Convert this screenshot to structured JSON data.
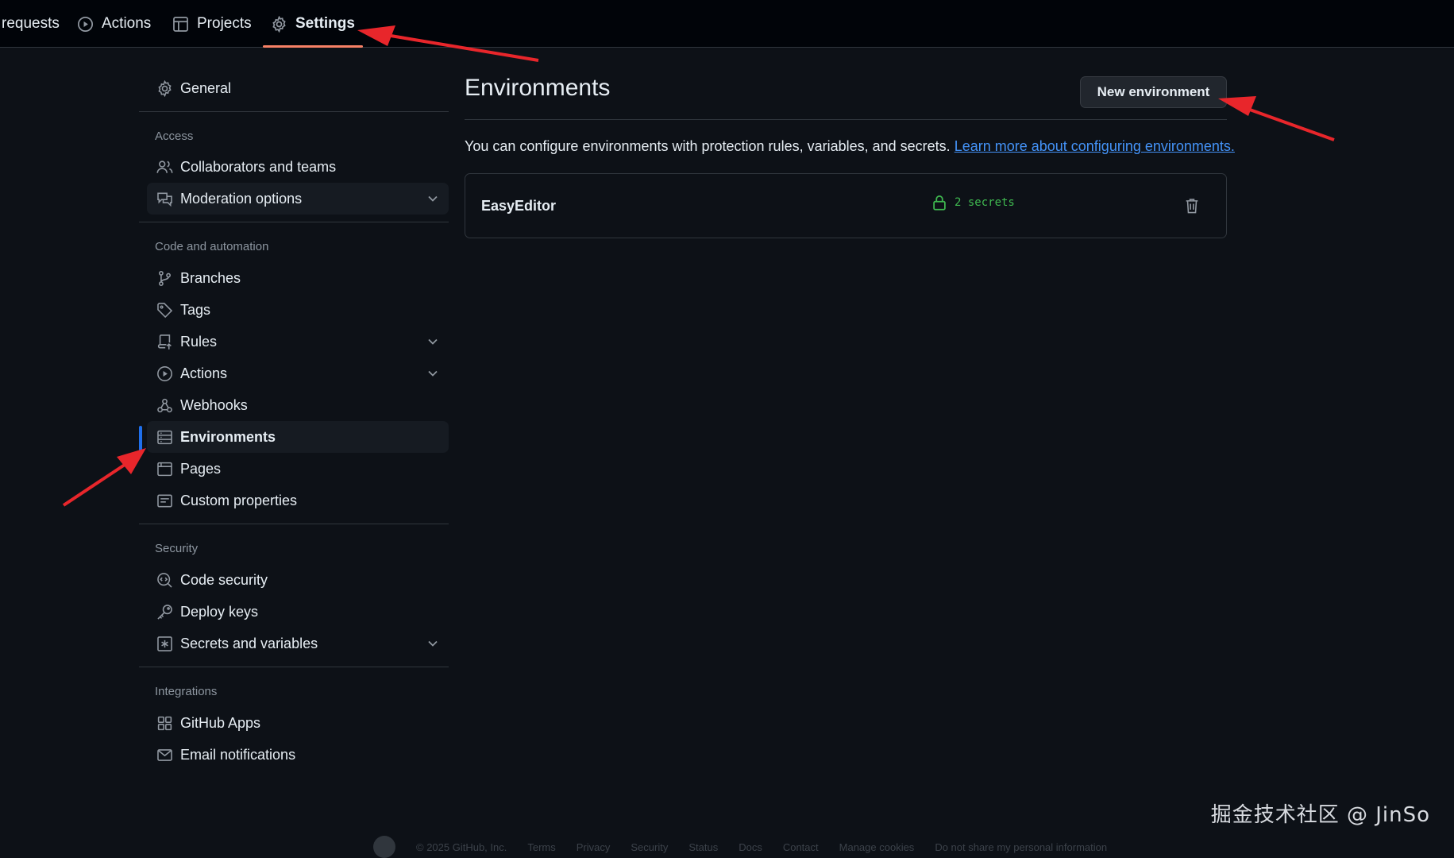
{
  "nav": {
    "tabs": [
      {
        "label": "requests",
        "icon": "pull-request-icon"
      },
      {
        "label": "Actions",
        "icon": "play-circle-icon"
      },
      {
        "label": "Projects",
        "icon": "table-icon"
      },
      {
        "label": "Settings",
        "icon": "gear-icon",
        "selected": true
      }
    ]
  },
  "sidebar": {
    "general": "General",
    "sections": {
      "access": "Access",
      "code_automation": "Code and automation",
      "security": "Security",
      "integrations": "Integrations"
    },
    "items": {
      "collaborators": "Collaborators and teams",
      "moderation": "Moderation options",
      "branches": "Branches",
      "tags": "Tags",
      "rules": "Rules",
      "actions": "Actions",
      "webhooks": "Webhooks",
      "environments": "Environments",
      "pages": "Pages",
      "custom_properties": "Custom properties",
      "code_security": "Code security",
      "deploy_keys": "Deploy keys",
      "secrets_variables": "Secrets and variables",
      "github_apps": "GitHub Apps",
      "email_notifications": "Email notifications"
    },
    "active_item": "Environments"
  },
  "main": {
    "title": "Environments",
    "new_button": "New environment",
    "description": "You can configure environments with protection rules, variables, and secrets.",
    "learn_more": "Learn more about configuring environments.",
    "environments": [
      {
        "name": "EasyEditor",
        "secrets": "2 secrets"
      }
    ]
  },
  "colors": {
    "background": "#0d1117",
    "topbar": "#010409",
    "accent_blue": "#1f6feb",
    "link": "#4493f8",
    "success_green": "#3fb950",
    "selected_underline": "#f78166",
    "annotation_red": "#e8262b"
  },
  "watermark": "掘金技术社区 @ JinSo",
  "footer": {
    "copyright": "© 2025 GitHub, Inc.",
    "links": [
      "Terms",
      "Privacy",
      "Security",
      "Status",
      "Docs",
      "Contact",
      "Manage cookies",
      "Do not share my personal information"
    ]
  }
}
